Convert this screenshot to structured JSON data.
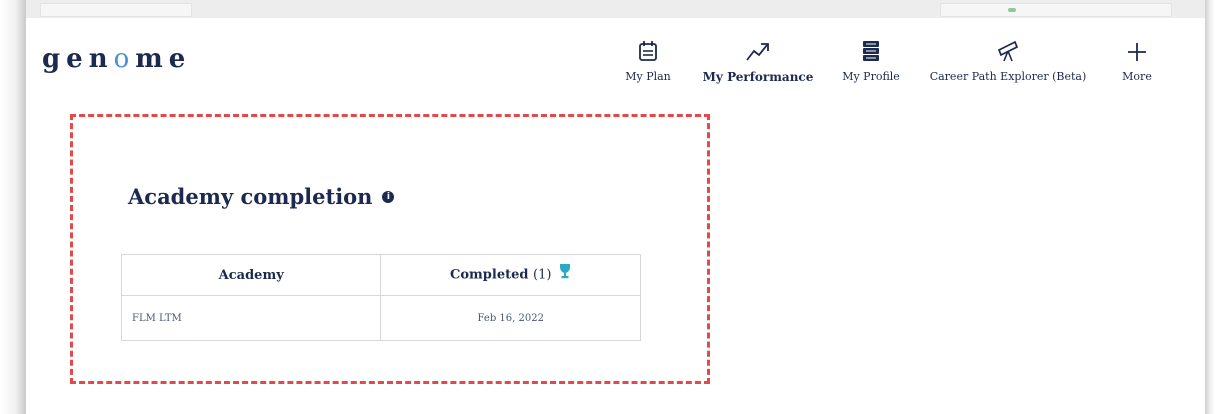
{
  "brand": {
    "logo_prefix": "gen",
    "logo_o": "o",
    "logo_suffix": "me"
  },
  "nav": {
    "items": [
      {
        "label": "My Plan",
        "icon": "calendar-icon",
        "active": false
      },
      {
        "label": "My Performance",
        "icon": "trend-up-icon",
        "active": true
      },
      {
        "label": "My Profile",
        "icon": "profile-stack-icon",
        "active": false
      },
      {
        "label": "Career Path Explorer (Beta)",
        "icon": "telescope-icon",
        "active": false
      },
      {
        "label": "More",
        "icon": "plus-icon",
        "active": false
      }
    ]
  },
  "section": {
    "title": "Academy completion",
    "info_icon": "info-icon",
    "info_glyph": "i"
  },
  "table": {
    "headers": {
      "academy": "Academy",
      "completed": "Completed",
      "completed_count": "(1)",
      "completed_icon": "trophy-icon"
    },
    "rows": [
      {
        "academy": "FLM LTM",
        "completed": "Feb 16, 2022"
      }
    ]
  },
  "colors": {
    "navy": "#1c2a4f",
    "highlight_dash": "#e04a4a",
    "trophy": "#2aa8c4",
    "logo_accent": "#4a8fd4"
  }
}
